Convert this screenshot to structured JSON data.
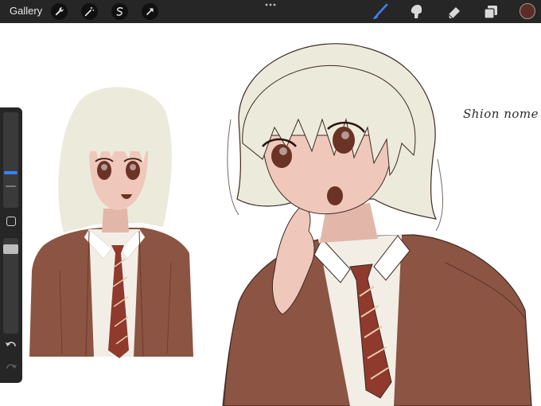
{
  "toolbar": {
    "gallery_label": "Gallery",
    "left_tools": [
      "wrench-icon",
      "magic-wand-icon",
      "selection-icon",
      "transform-arrow-icon"
    ],
    "right_tools": [
      "brush-icon",
      "smudge-icon",
      "eraser-icon",
      "layers-icon"
    ],
    "active_tool": "brush-icon",
    "active_tool_color": "#3b82f6",
    "current_color": "#5e2c26"
  },
  "sidebar": {
    "brush_size_accent": "#3b82f6",
    "modify_button": "square-icon",
    "undo": "undo-arrow-icon",
    "redo": "redo-arrow-icon"
  },
  "canvas": {
    "handwritten_note": "Shion nome"
  }
}
